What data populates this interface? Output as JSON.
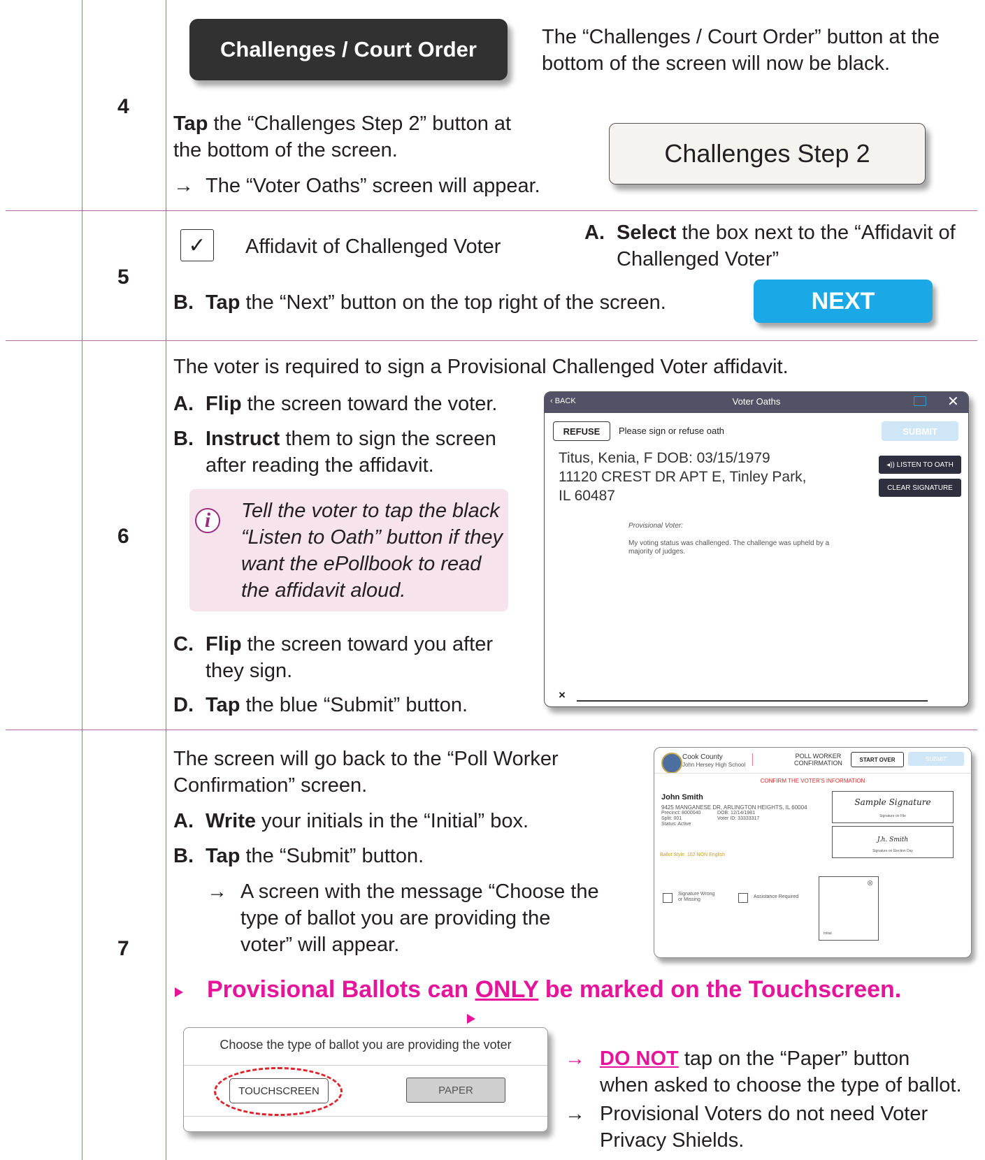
{
  "steps": {
    "s4": {
      "num": "4",
      "court_button": "Challenges / Court Order",
      "court_note_1": "The “Challenges / Court Order” button at the",
      "court_note_2": "bottom of the screen will now be black.",
      "tap": "Tap",
      "tap_rest": " the “Challenges Step 2” button at",
      "tap_line2": "the bottom of the screen.",
      "arrow": "→",
      "result": "The “Voter Oaths” screen will appear.",
      "step2_button": "Challenges Step 2"
    },
    "s5": {
      "num": "5",
      "checkbox_mark": "✓",
      "affidavit_label": "Affidavit of Challenged Voter",
      "a_label": "A.",
      "a_bold": "Select",
      "a_rest": " the box next to the “Affidavit of",
      "a_line2": "Challenged Voter”",
      "b_label": "B.",
      "b_bold": "Tap",
      "b_rest": " the “Next” button on the top right of the screen.",
      "next_button": "NEXT"
    },
    "s6": {
      "num": "6",
      "intro": "The voter is required to sign a Provisional Challenged Voter affidavit.",
      "a_label": "A.",
      "a_bold": "Flip",
      "a_rest": " the screen toward the voter.",
      "b_label": "B.",
      "b_bold": "Instruct",
      "b_rest": " them to sign the screen",
      "b_line2": "after reading the affidavit.",
      "info_icon": "i",
      "info_1": "Tell the voter to tap the black",
      "info_2": "“Listen to Oath” button if they",
      "info_3": "want the ePollbook to read",
      "info_4": "the affidavit aloud.",
      "c_label": "C.",
      "c_bold": "Flip",
      "c_rest": " the screen toward you after",
      "c_line2": "they sign.",
      "d_label": "D.",
      "d_bold": "Tap",
      "d_rest": " the blue “Submit” button."
    },
    "s7": {
      "num": "7",
      "intro_1": "The screen will go back to the “Poll Worker",
      "intro_2": "Confirmation” screen.",
      "a_label": "A.",
      "a_bold": "Write",
      "a_rest": " your initials in the “Initial” box.",
      "b_label": "B.",
      "b_bold": "Tap",
      "b_rest": " the “Submit” button.",
      "arrow": "→",
      "msg_1": "A screen with the message “Choose the",
      "msg_2": "type of ballot you are providing the",
      "msg_3": "voter” will appear.",
      "note_pre": "Provisional Ballots can ",
      "note_only": "ONLY",
      "note_post": " be marked on the Touchscreen.",
      "dn_arrow": "→",
      "dn_bold": "DO NOT",
      "dn_rest": " tap on the “Paper” button",
      "dn_line2": "when asked to choose the type of ballot.",
      "pv_arrow": "→",
      "pv_1": "Provisional Voters do not need Voter",
      "pv_2": "Privacy Shields."
    }
  },
  "voter_oaths_screen": {
    "back": "‹ BACK",
    "title": "Voter Oaths",
    "close": "✕",
    "refuse": "REFUSE",
    "prompt": "Please sign or refuse oath",
    "submit": "SUBMIT",
    "voter_line1": "Titus, Kenia, F DOB: 03/15/1979",
    "voter_line2": "11120 CREST DR APT E, Tinley Park,",
    "voter_line3": "IL 60487",
    "listen": "◂)) LISTEN TO OATH",
    "clear": "CLEAR SIGNATURE",
    "prov_label": "Provisional Voter:",
    "prov_text": "My voting status was challenged. The challenge was upheld by a majority of judges.",
    "sig_x": "×"
  },
  "poll_worker_screen": {
    "county": "Cook County",
    "school": "John Hersey High School",
    "header_1": "POLL WORKER",
    "header_2": "CONFIRMATION",
    "start_over": "START OVER",
    "submit": "SUBMIT",
    "confirm": "CONFIRM THE VOTER'S INFORMATION",
    "name": "John Smith",
    "address": "9425 MANGANESE DR, ARLINGTON HEIGHTS, IL 60004",
    "precinct": "Precinct: 8000040",
    "dob": "DOB: 12/14/1981",
    "split": "Split: 001",
    "voter_id": "Voter ID: 33333317",
    "status": "Status: Active",
    "sig_sample": "Sample Signature",
    "sig_on_file": "Signature on File",
    "sig_day_text": "J.h. Smith",
    "sig_election_day": "Signature on Election Day",
    "ballot_style": "Ballot Style: 102 NON English",
    "sig_wrong_1": "Signature Wrong",
    "sig_wrong_2": "or Missing",
    "assistance": "Assistance Required",
    "initial": "Initial",
    "initial_close": "⊗"
  },
  "ballot_chooser": {
    "title": "Choose the type of ballot you are providing the voter",
    "touchscreen": "TOUCHSCREEN",
    "paper": "PAPER"
  },
  "colors": {
    "rule": "#b06aa8",
    "magenta": "#e5149b",
    "next_blue": "#1aa9e6",
    "dark_button": "#313131",
    "info_bg": "#f6e3ec"
  }
}
